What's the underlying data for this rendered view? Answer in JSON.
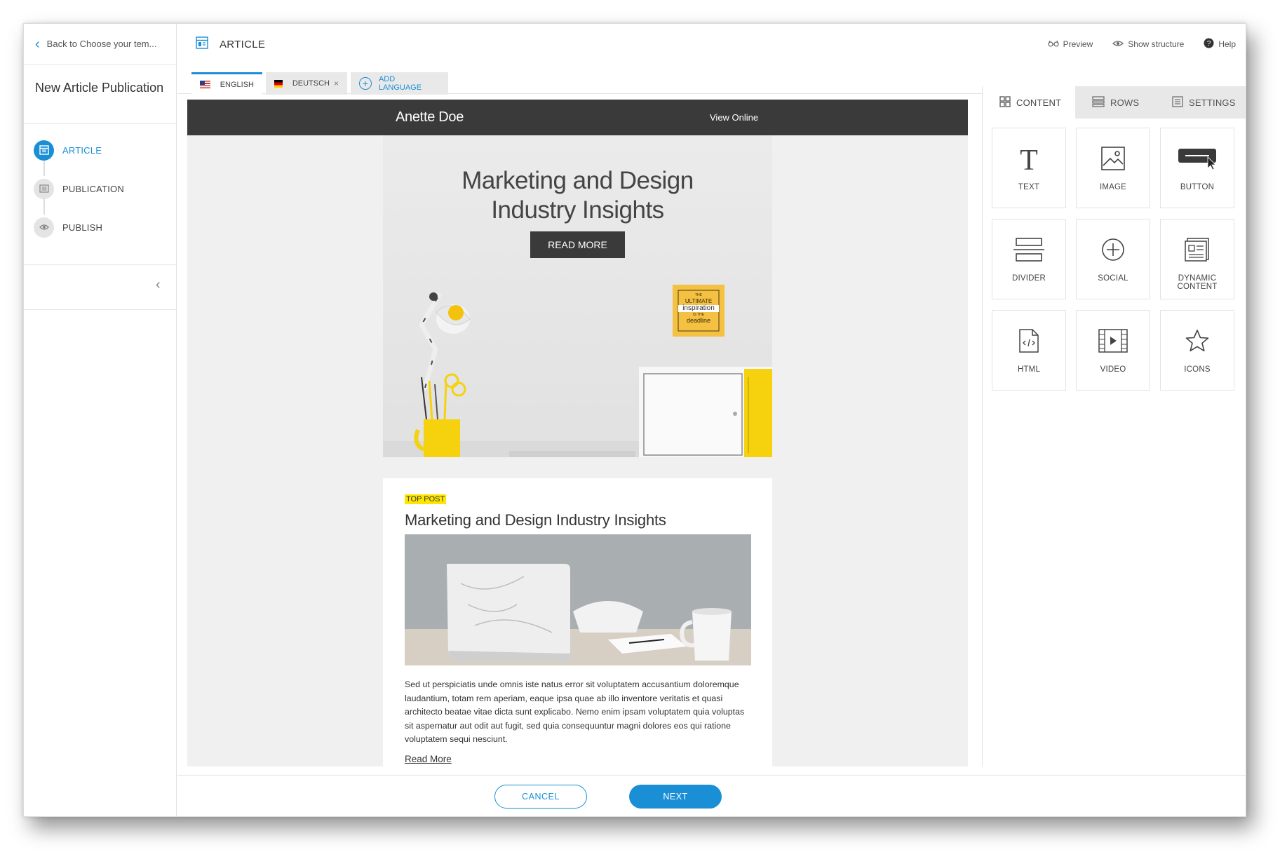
{
  "sidebar": {
    "back_label": "Back to Choose your tem...",
    "title": "New Article Publication",
    "steps": [
      {
        "label": "ARTICLE",
        "icon": "article-icon",
        "active": true
      },
      {
        "label": "PUBLICATION",
        "icon": "publication-icon",
        "active": false
      },
      {
        "label": "PUBLISH",
        "icon": "eye-icon",
        "active": false
      }
    ]
  },
  "topbar": {
    "title": "ARTICLE",
    "actions": [
      {
        "label": "Preview",
        "icon": "preview-icon"
      },
      {
        "label": "Show structure",
        "icon": "eye-icon"
      },
      {
        "label": "Help",
        "icon": "help-icon"
      }
    ]
  },
  "languages": {
    "tabs": [
      {
        "label": "ENGLISH",
        "flag": "us-flag",
        "active": true
      },
      {
        "label": "DEUTSCH",
        "flag": "de-flag",
        "active": false,
        "closable": true
      }
    ],
    "add_label": "ADD LANGUAGE"
  },
  "email": {
    "header_name": "Anette Doe",
    "view_online": "View Online",
    "hero_title_line1": "Marketing and Design",
    "hero_title_line2": "Industry Insights",
    "hero_button": "READ MORE",
    "sticky_note": {
      "line1": "THE",
      "line2": "ULTIMATE",
      "line3": "inspiration",
      "line4": "IS THE",
      "line5": "deadline"
    },
    "post": {
      "tag": "TOP POST",
      "title": "Marketing and Design Industry Insights",
      "body": "Sed ut perspiciatis unde omnis iste natus error sit voluptatem accusantium doloremque laudantium, totam rem aperiam, eaque ipsa quae ab illo inventore veritatis et quasi architecto beatae vitae dicta sunt explicabo. Nemo enim ipsam voluptatem quia voluptas sit aspernatur aut odit aut fugit, sed quia consequuntur magni dolores eos qui ratione voluptatem sequi nesciunt.",
      "read_more": "Read More"
    }
  },
  "panel": {
    "tabs": [
      {
        "label": "CONTENT",
        "icon": "grid-icon",
        "active": true
      },
      {
        "label": "ROWS",
        "icon": "rows-icon",
        "active": false
      },
      {
        "label": "SETTINGS",
        "icon": "settings-icon",
        "active": false
      }
    ],
    "blocks": [
      {
        "label": "TEXT",
        "icon": "text-icon"
      },
      {
        "label": "IMAGE",
        "icon": "image-icon"
      },
      {
        "label": "BUTTON",
        "icon": "button-icon"
      },
      {
        "label": "DIVIDER",
        "icon": "divider-icon"
      },
      {
        "label": "SOCIAL",
        "icon": "social-icon"
      },
      {
        "label": "DYNAMIC CONTENT",
        "icon": "dynamic-content-icon"
      },
      {
        "label": "HTML",
        "icon": "html-icon"
      },
      {
        "label": "VIDEO",
        "icon": "video-icon"
      },
      {
        "label": "ICONS",
        "icon": "star-icon"
      }
    ]
  },
  "footer": {
    "cancel_label": "CANCEL",
    "next_label": "NEXT"
  },
  "colors": {
    "accent": "#1a8fd6",
    "dark_header": "#3a3a3a",
    "tag_highlight": "#ffe600",
    "canvas_bg": "#f0f0f0"
  }
}
